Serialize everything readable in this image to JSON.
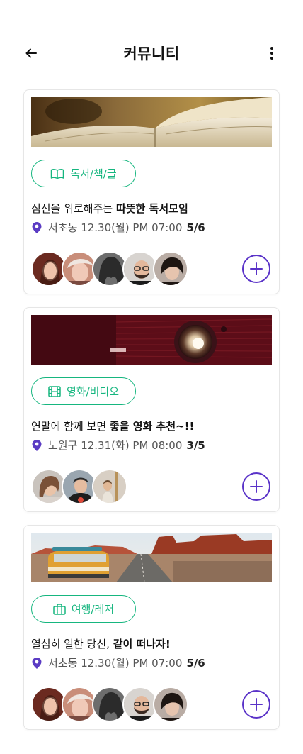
{
  "header": {
    "title": "커뮤니티",
    "back_icon": "arrow-left-icon",
    "more_icon": "more-vertical-icon"
  },
  "colors": {
    "accent_green": "#16b67f",
    "accent_purple": "#5a33c8",
    "pin_purple": "#5b3cc4"
  },
  "cards": [
    {
      "image": "open-book-photo",
      "tag": {
        "icon": "book-icon",
        "label": "독서/책/글"
      },
      "title_plain": "심신을 위로해주는 ",
      "title_bold": "따뜻한 독서모임",
      "location": "서초동",
      "datetime": "12.30(월) PM 07:00",
      "count": "5/6",
      "participants": 5
    },
    {
      "image": "projector-photo",
      "tag": {
        "icon": "film-icon",
        "label": "영화/비디오"
      },
      "title_plain": "연말에 함께 보면 ",
      "title_bold": "좋을 영화 추천~!!",
      "location": "노원구",
      "datetime": "12.31(화) PM 08:00",
      "count": "3/5",
      "participants": 3
    },
    {
      "image": "van-desert-photo",
      "tag": {
        "icon": "suitcase-icon",
        "label": "여행/레저"
      },
      "title_plain": "열심히 일한 당신, ",
      "title_bold": "같이 떠나자!",
      "location": "서초동",
      "datetime": "12.30(월) PM 07:00",
      "count": "5/6",
      "participants": 5
    }
  ]
}
